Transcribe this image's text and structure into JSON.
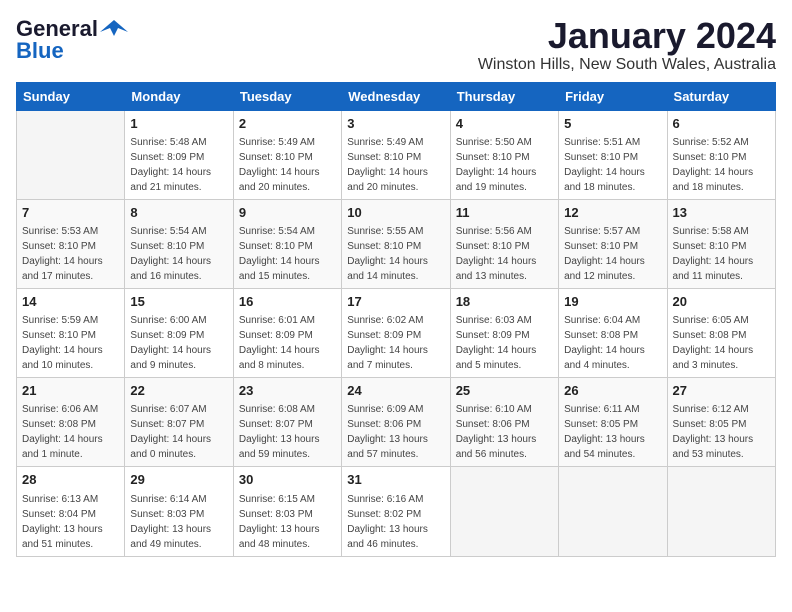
{
  "header": {
    "logo_general": "General",
    "logo_blue": "Blue",
    "title": "January 2024",
    "subtitle": "Winston Hills, New South Wales, Australia"
  },
  "days_of_week": [
    "Sunday",
    "Monday",
    "Tuesday",
    "Wednesday",
    "Thursday",
    "Friday",
    "Saturday"
  ],
  "weeks": [
    [
      {
        "day": "",
        "info": ""
      },
      {
        "day": "1",
        "info": "Sunrise: 5:48 AM\nSunset: 8:09 PM\nDaylight: 14 hours\nand 21 minutes."
      },
      {
        "day": "2",
        "info": "Sunrise: 5:49 AM\nSunset: 8:10 PM\nDaylight: 14 hours\nand 20 minutes."
      },
      {
        "day": "3",
        "info": "Sunrise: 5:49 AM\nSunset: 8:10 PM\nDaylight: 14 hours\nand 20 minutes."
      },
      {
        "day": "4",
        "info": "Sunrise: 5:50 AM\nSunset: 8:10 PM\nDaylight: 14 hours\nand 19 minutes."
      },
      {
        "day": "5",
        "info": "Sunrise: 5:51 AM\nSunset: 8:10 PM\nDaylight: 14 hours\nand 18 minutes."
      },
      {
        "day": "6",
        "info": "Sunrise: 5:52 AM\nSunset: 8:10 PM\nDaylight: 14 hours\nand 18 minutes."
      }
    ],
    [
      {
        "day": "7",
        "info": "Sunrise: 5:53 AM\nSunset: 8:10 PM\nDaylight: 14 hours\nand 17 minutes."
      },
      {
        "day": "8",
        "info": "Sunrise: 5:54 AM\nSunset: 8:10 PM\nDaylight: 14 hours\nand 16 minutes."
      },
      {
        "day": "9",
        "info": "Sunrise: 5:54 AM\nSunset: 8:10 PM\nDaylight: 14 hours\nand 15 minutes."
      },
      {
        "day": "10",
        "info": "Sunrise: 5:55 AM\nSunset: 8:10 PM\nDaylight: 14 hours\nand 14 minutes."
      },
      {
        "day": "11",
        "info": "Sunrise: 5:56 AM\nSunset: 8:10 PM\nDaylight: 14 hours\nand 13 minutes."
      },
      {
        "day": "12",
        "info": "Sunrise: 5:57 AM\nSunset: 8:10 PM\nDaylight: 14 hours\nand 12 minutes."
      },
      {
        "day": "13",
        "info": "Sunrise: 5:58 AM\nSunset: 8:10 PM\nDaylight: 14 hours\nand 11 minutes."
      }
    ],
    [
      {
        "day": "14",
        "info": "Sunrise: 5:59 AM\nSunset: 8:10 PM\nDaylight: 14 hours\nand 10 minutes."
      },
      {
        "day": "15",
        "info": "Sunrise: 6:00 AM\nSunset: 8:09 PM\nDaylight: 14 hours\nand 9 minutes."
      },
      {
        "day": "16",
        "info": "Sunrise: 6:01 AM\nSunset: 8:09 PM\nDaylight: 14 hours\nand 8 minutes."
      },
      {
        "day": "17",
        "info": "Sunrise: 6:02 AM\nSunset: 8:09 PM\nDaylight: 14 hours\nand 7 minutes."
      },
      {
        "day": "18",
        "info": "Sunrise: 6:03 AM\nSunset: 8:09 PM\nDaylight: 14 hours\nand 5 minutes."
      },
      {
        "day": "19",
        "info": "Sunrise: 6:04 AM\nSunset: 8:08 PM\nDaylight: 14 hours\nand 4 minutes."
      },
      {
        "day": "20",
        "info": "Sunrise: 6:05 AM\nSunset: 8:08 PM\nDaylight: 14 hours\nand 3 minutes."
      }
    ],
    [
      {
        "day": "21",
        "info": "Sunrise: 6:06 AM\nSunset: 8:08 PM\nDaylight: 14 hours\nand 1 minute."
      },
      {
        "day": "22",
        "info": "Sunrise: 6:07 AM\nSunset: 8:07 PM\nDaylight: 14 hours\nand 0 minutes."
      },
      {
        "day": "23",
        "info": "Sunrise: 6:08 AM\nSunset: 8:07 PM\nDaylight: 13 hours\nand 59 minutes."
      },
      {
        "day": "24",
        "info": "Sunrise: 6:09 AM\nSunset: 8:06 PM\nDaylight: 13 hours\nand 57 minutes."
      },
      {
        "day": "25",
        "info": "Sunrise: 6:10 AM\nSunset: 8:06 PM\nDaylight: 13 hours\nand 56 minutes."
      },
      {
        "day": "26",
        "info": "Sunrise: 6:11 AM\nSunset: 8:05 PM\nDaylight: 13 hours\nand 54 minutes."
      },
      {
        "day": "27",
        "info": "Sunrise: 6:12 AM\nSunset: 8:05 PM\nDaylight: 13 hours\nand 53 minutes."
      }
    ],
    [
      {
        "day": "28",
        "info": "Sunrise: 6:13 AM\nSunset: 8:04 PM\nDaylight: 13 hours\nand 51 minutes."
      },
      {
        "day": "29",
        "info": "Sunrise: 6:14 AM\nSunset: 8:03 PM\nDaylight: 13 hours\nand 49 minutes."
      },
      {
        "day": "30",
        "info": "Sunrise: 6:15 AM\nSunset: 8:03 PM\nDaylight: 13 hours\nand 48 minutes."
      },
      {
        "day": "31",
        "info": "Sunrise: 6:16 AM\nSunset: 8:02 PM\nDaylight: 13 hours\nand 46 minutes."
      },
      {
        "day": "",
        "info": ""
      },
      {
        "day": "",
        "info": ""
      },
      {
        "day": "",
        "info": ""
      }
    ]
  ]
}
